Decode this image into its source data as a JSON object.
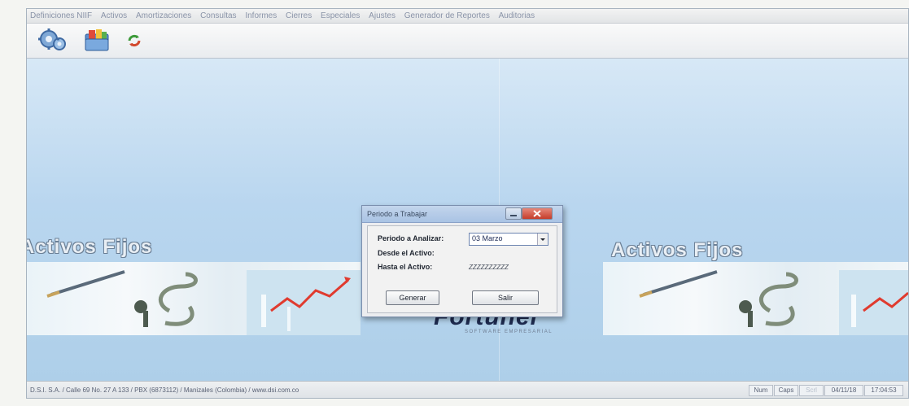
{
  "menu": {
    "items": [
      "Definiciones NIIF",
      "Activos",
      "Amortizaciones",
      "Consultas",
      "Informes",
      "Cierres",
      "Especiales",
      "Ajustes",
      "Generador de Reportes",
      "Auditorias"
    ]
  },
  "toolbar": {
    "icons": [
      "gears-icon",
      "folders-icon",
      "refresh-icon"
    ]
  },
  "desktop": {
    "banner_title_left": "Activos Fijos",
    "banner_title_right": "Activos Fijos",
    "logo_text": "Fortuner",
    "logo_sub": "SOFTWARE EMPRESARIAL"
  },
  "dialog": {
    "title": "Periodo a Trabajar",
    "period_label": "Periodo a Analizar:",
    "period_value": "03 Marzo",
    "from_label": "Desde el Activo:",
    "from_value": "",
    "to_label": "Hasta el Activo:",
    "to_value": "ZZZZZZZZZZ",
    "generate_label": "Generar",
    "exit_label": "Salir"
  },
  "statusbar": {
    "company_info": "D.S.I. S.A. / Calle 69 No. 27 A 133 / PBX (6873112) / Manizales (Colombia) / www.dsi.com.co",
    "num": "Num",
    "caps": "Caps",
    "scrl": "Scrl",
    "date": "04/11/18",
    "time": "17:04:53"
  }
}
